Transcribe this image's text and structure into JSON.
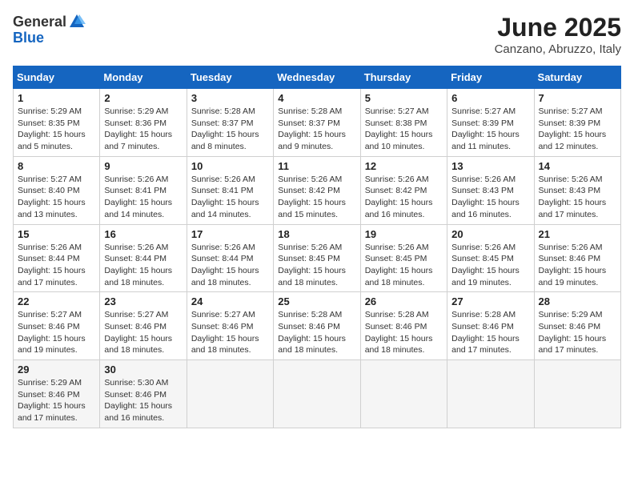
{
  "header": {
    "logo_general": "General",
    "logo_blue": "Blue",
    "month_title": "June 2025",
    "subtitle": "Canzano, Abruzzo, Italy"
  },
  "days_of_week": [
    "Sunday",
    "Monday",
    "Tuesday",
    "Wednesday",
    "Thursday",
    "Friday",
    "Saturday"
  ],
  "weeks": [
    [
      {
        "day": "1",
        "sunrise": "5:29 AM",
        "sunset": "8:35 PM",
        "daylight": "15 hours and 5 minutes."
      },
      {
        "day": "2",
        "sunrise": "5:29 AM",
        "sunset": "8:36 PM",
        "daylight": "15 hours and 7 minutes."
      },
      {
        "day": "3",
        "sunrise": "5:28 AM",
        "sunset": "8:37 PM",
        "daylight": "15 hours and 8 minutes."
      },
      {
        "day": "4",
        "sunrise": "5:28 AM",
        "sunset": "8:37 PM",
        "daylight": "15 hours and 9 minutes."
      },
      {
        "day": "5",
        "sunrise": "5:27 AM",
        "sunset": "8:38 PM",
        "daylight": "15 hours and 10 minutes."
      },
      {
        "day": "6",
        "sunrise": "5:27 AM",
        "sunset": "8:39 PM",
        "daylight": "15 hours and 11 minutes."
      },
      {
        "day": "7",
        "sunrise": "5:27 AM",
        "sunset": "8:39 PM",
        "daylight": "15 hours and 12 minutes."
      }
    ],
    [
      {
        "day": "8",
        "sunrise": "5:27 AM",
        "sunset": "8:40 PM",
        "daylight": "15 hours and 13 minutes."
      },
      {
        "day": "9",
        "sunrise": "5:26 AM",
        "sunset": "8:41 PM",
        "daylight": "15 hours and 14 minutes."
      },
      {
        "day": "10",
        "sunrise": "5:26 AM",
        "sunset": "8:41 PM",
        "daylight": "15 hours and 14 minutes."
      },
      {
        "day": "11",
        "sunrise": "5:26 AM",
        "sunset": "8:42 PM",
        "daylight": "15 hours and 15 minutes."
      },
      {
        "day": "12",
        "sunrise": "5:26 AM",
        "sunset": "8:42 PM",
        "daylight": "15 hours and 16 minutes."
      },
      {
        "day": "13",
        "sunrise": "5:26 AM",
        "sunset": "8:43 PM",
        "daylight": "15 hours and 16 minutes."
      },
      {
        "day": "14",
        "sunrise": "5:26 AM",
        "sunset": "8:43 PM",
        "daylight": "15 hours and 17 minutes."
      }
    ],
    [
      {
        "day": "15",
        "sunrise": "5:26 AM",
        "sunset": "8:44 PM",
        "daylight": "15 hours and 17 minutes."
      },
      {
        "day": "16",
        "sunrise": "5:26 AM",
        "sunset": "8:44 PM",
        "daylight": "15 hours and 18 minutes."
      },
      {
        "day": "17",
        "sunrise": "5:26 AM",
        "sunset": "8:44 PM",
        "daylight": "15 hours and 18 minutes."
      },
      {
        "day": "18",
        "sunrise": "5:26 AM",
        "sunset": "8:45 PM",
        "daylight": "15 hours and 18 minutes."
      },
      {
        "day": "19",
        "sunrise": "5:26 AM",
        "sunset": "8:45 PM",
        "daylight": "15 hours and 18 minutes."
      },
      {
        "day": "20",
        "sunrise": "5:26 AM",
        "sunset": "8:45 PM",
        "daylight": "15 hours and 19 minutes."
      },
      {
        "day": "21",
        "sunrise": "5:26 AM",
        "sunset": "8:46 PM",
        "daylight": "15 hours and 19 minutes."
      }
    ],
    [
      {
        "day": "22",
        "sunrise": "5:27 AM",
        "sunset": "8:46 PM",
        "daylight": "15 hours and 19 minutes."
      },
      {
        "day": "23",
        "sunrise": "5:27 AM",
        "sunset": "8:46 PM",
        "daylight": "15 hours and 18 minutes."
      },
      {
        "day": "24",
        "sunrise": "5:27 AM",
        "sunset": "8:46 PM",
        "daylight": "15 hours and 18 minutes."
      },
      {
        "day": "25",
        "sunrise": "5:28 AM",
        "sunset": "8:46 PM",
        "daylight": "15 hours and 18 minutes."
      },
      {
        "day": "26",
        "sunrise": "5:28 AM",
        "sunset": "8:46 PM",
        "daylight": "15 hours and 18 minutes."
      },
      {
        "day": "27",
        "sunrise": "5:28 AM",
        "sunset": "8:46 PM",
        "daylight": "15 hours and 17 minutes."
      },
      {
        "day": "28",
        "sunrise": "5:29 AM",
        "sunset": "8:46 PM",
        "daylight": "15 hours and 17 minutes."
      }
    ],
    [
      {
        "day": "29",
        "sunrise": "5:29 AM",
        "sunset": "8:46 PM",
        "daylight": "15 hours and 17 minutes."
      },
      {
        "day": "30",
        "sunrise": "5:30 AM",
        "sunset": "8:46 PM",
        "daylight": "15 hours and 16 minutes."
      },
      null,
      null,
      null,
      null,
      null
    ]
  ],
  "labels": {
    "sunrise": "Sunrise:",
    "sunset": "Sunset:",
    "daylight": "Daylight:"
  }
}
